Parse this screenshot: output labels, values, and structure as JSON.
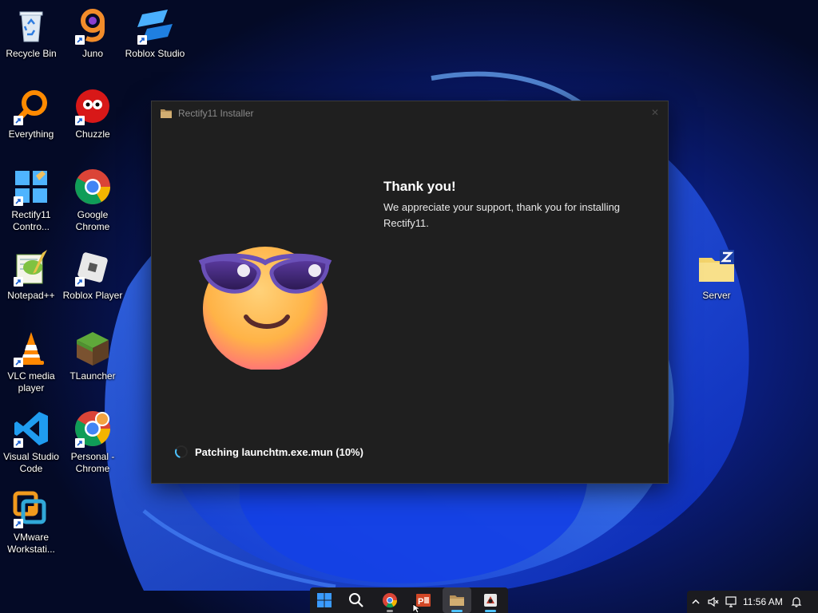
{
  "desktop": {
    "icons_col1": [
      {
        "label": "Recycle Bin"
      },
      {
        "label": "Everything"
      },
      {
        "label": "Rectify11 Contro..."
      },
      {
        "label": "Notepad++"
      },
      {
        "label": "VLC media player"
      },
      {
        "label": "Visual Studio Code"
      },
      {
        "label": "VMware Workstati..."
      }
    ],
    "icons_col2": [
      {
        "label": "Juno"
      },
      {
        "label": "Chuzzle"
      },
      {
        "label": "Google Chrome"
      },
      {
        "label": "Roblox Player"
      },
      {
        "label": "TLauncher"
      },
      {
        "label": "Personal - Chrome"
      }
    ],
    "icons_other": [
      {
        "label": "Roblox Studio"
      },
      {
        "label": "Server"
      }
    ]
  },
  "installer": {
    "title": "Rectify11 Installer",
    "heading": "Thank you!",
    "message": "We appreciate your support, thank you for installing Rectify11.",
    "status": "Patching launchtm.exe.mun (10%)",
    "progress_percent": 10
  },
  "taskbar": {
    "items": [
      "start-icon",
      "search-icon",
      "chrome-icon",
      "powerpoint-icon",
      "installer-icon",
      "app-icon"
    ],
    "accent": "#4cc2ff"
  },
  "tray": {
    "time": "11:56 AM"
  },
  "colors": {
    "window_bg": "#1f1f1f",
    "taskbar_bg": "#1b1b1f",
    "wallpaper_bg": "#050b2a"
  }
}
